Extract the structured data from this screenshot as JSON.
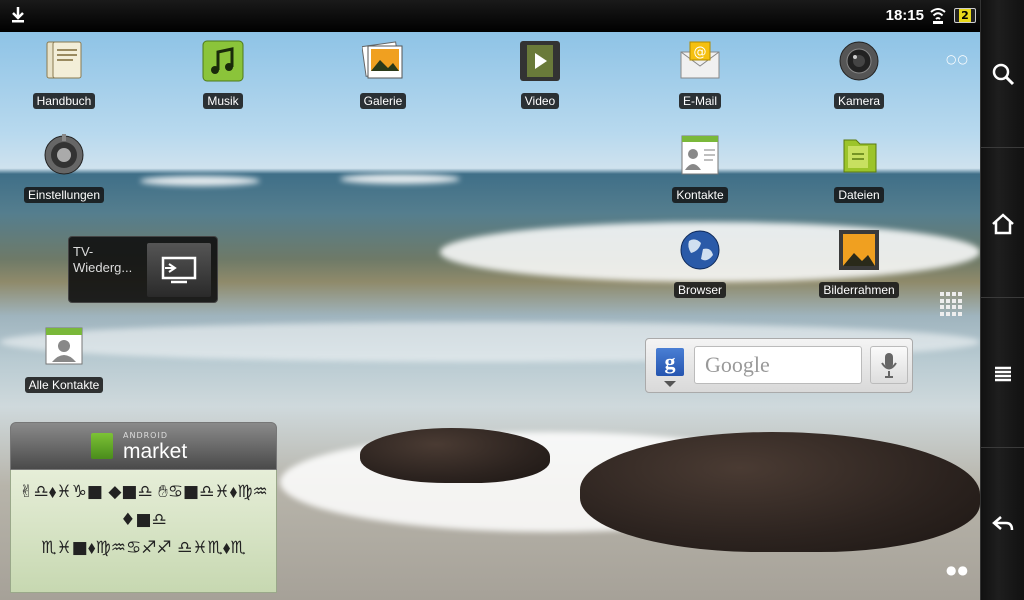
{
  "status_bar": {
    "time": "18:15",
    "battery_text": "2",
    "icons": [
      "download-icon",
      "wifi-icon",
      "battery-icon"
    ]
  },
  "apps": [
    {
      "label": "Handbuch",
      "icon": "manual-icon"
    },
    {
      "label": "Musik",
      "icon": "music-icon"
    },
    {
      "label": "Galerie",
      "icon": "gallery-icon"
    },
    {
      "label": "Video",
      "icon": "video-icon"
    },
    {
      "label": "E-Mail",
      "icon": "email-icon"
    },
    {
      "label": "Kamera",
      "icon": "camera-icon"
    },
    {
      "label": "Einstellungen",
      "icon": "settings-icon"
    },
    {
      "label": "Kontakte",
      "icon": "contacts-icon"
    },
    {
      "label": "Dateien",
      "icon": "files-icon"
    },
    {
      "label": "Browser",
      "icon": "browser-icon"
    },
    {
      "label": "Bilderrahmen",
      "icon": "picture-frame-icon"
    },
    {
      "label": "Alle Kontakte",
      "icon": "all-contacts-icon"
    }
  ],
  "tv_widget": {
    "label": "TV-Wiederg..."
  },
  "google_widget": {
    "logo": "g",
    "placeholder": "Google"
  },
  "market_widget": {
    "brand_small": "ANDROID",
    "brand": "market",
    "lines": [
      "✌︎♎︎⬧︎♓︎♑︎■︎ ◆︎■︎♎︎ ✋︎♋︎■︎♎︎♓︎⬧︎♍︎♒︎",
      "♦︎■︎♎︎",
      "♏︎♓︎■︎⬧︎♍︎♒︎♋︎♐︎♐︎ ♎︎♓︎♏︎⬧︎♏︎"
    ]
  },
  "system_bar": [
    "search-icon",
    "home-icon",
    "menu-icon",
    "back-icon"
  ],
  "colors": {
    "accent_green": "#7cc236",
    "status_bar": "#000000"
  }
}
